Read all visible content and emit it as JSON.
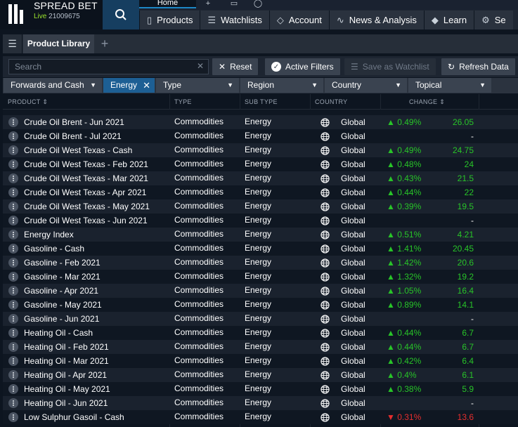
{
  "app": {
    "brand_name": "SPREAD BET",
    "live_label": "Live",
    "account_number": "21009675"
  },
  "top_nav": {
    "home_tab": "Home",
    "items": [
      {
        "label": "Products",
        "icon": "book-icon"
      },
      {
        "label": "Watchlists",
        "icon": "list-icon"
      },
      {
        "label": "Account",
        "icon": "tag-icon"
      },
      {
        "label": "News & Analysis",
        "icon": "pulse-icon"
      },
      {
        "label": "Learn",
        "icon": "mortarboard-icon"
      },
      {
        "label": "Se",
        "icon": "gear-icon"
      }
    ]
  },
  "tabs": {
    "product_library": "Product Library"
  },
  "toolbar": {
    "search_placeholder": "Search",
    "reset_label": "Reset",
    "active_filters_label": "Active Filters",
    "save_watchlist_label": "Save as Watchlist",
    "refresh_label": "Refresh Data"
  },
  "filters": {
    "forwards": "Forwards and Cash",
    "energy": "Energy",
    "type": "Type",
    "region": "Region",
    "country": "Country",
    "topical": "Topical"
  },
  "columns": {
    "product": "PRODUCT",
    "type": "TYPE",
    "sub_type": "SUB TYPE",
    "country": "COUNTRY",
    "change": "CHANGE"
  },
  "rows": [
    {
      "name": "Crude Oil Brent - Jun 2021",
      "type": "Commodities",
      "sub_type": "Energy",
      "country": "Global",
      "change_pct": "0.49%",
      "dir": "up",
      "value": "26.05"
    },
    {
      "name": "Crude Oil Brent - Jul 2021",
      "type": "Commodities",
      "sub_type": "Energy",
      "country": "Global",
      "change_pct": "",
      "dir": "none",
      "value": "-"
    },
    {
      "name": "Crude Oil West Texas - Cash",
      "type": "Commodities",
      "sub_type": "Energy",
      "country": "Global",
      "change_pct": "0.49%",
      "dir": "up",
      "value": "24.75"
    },
    {
      "name": "Crude Oil West Texas - Feb 2021",
      "type": "Commodities",
      "sub_type": "Energy",
      "country": "Global",
      "change_pct": "0.48%",
      "dir": "up",
      "value": "24"
    },
    {
      "name": "Crude Oil West Texas - Mar 2021",
      "type": "Commodities",
      "sub_type": "Energy",
      "country": "Global",
      "change_pct": "0.43%",
      "dir": "up",
      "value": "21.5"
    },
    {
      "name": "Crude Oil West Texas - Apr 2021",
      "type": "Commodities",
      "sub_type": "Energy",
      "country": "Global",
      "change_pct": "0.44%",
      "dir": "up",
      "value": "22"
    },
    {
      "name": "Crude Oil West Texas - May 2021",
      "type": "Commodities",
      "sub_type": "Energy",
      "country": "Global",
      "change_pct": "0.39%",
      "dir": "up",
      "value": "19.5"
    },
    {
      "name": "Crude Oil West Texas - Jun 2021",
      "type": "Commodities",
      "sub_type": "Energy",
      "country": "Global",
      "change_pct": "",
      "dir": "none",
      "value": "-"
    },
    {
      "name": "Energy Index",
      "type": "Commodities",
      "sub_type": "Energy",
      "country": "Global",
      "change_pct": "0.51%",
      "dir": "up",
      "value": "4.21"
    },
    {
      "name": "Gasoline - Cash",
      "type": "Commodities",
      "sub_type": "Energy",
      "country": "Global",
      "change_pct": "1.41%",
      "dir": "up",
      "value": "20.45"
    },
    {
      "name": "Gasoline - Feb 2021",
      "type": "Commodities",
      "sub_type": "Energy",
      "country": "Global",
      "change_pct": "1.42%",
      "dir": "up",
      "value": "20.6"
    },
    {
      "name": "Gasoline - Mar 2021",
      "type": "Commodities",
      "sub_type": "Energy",
      "country": "Global",
      "change_pct": "1.32%",
      "dir": "up",
      "value": "19.2"
    },
    {
      "name": "Gasoline - Apr 2021",
      "type": "Commodities",
      "sub_type": "Energy",
      "country": "Global",
      "change_pct": "1.05%",
      "dir": "up",
      "value": "16.4"
    },
    {
      "name": "Gasoline - May 2021",
      "type": "Commodities",
      "sub_type": "Energy",
      "country": "Global",
      "change_pct": "0.89%",
      "dir": "up",
      "value": "14.1"
    },
    {
      "name": "Gasoline - Jun 2021",
      "type": "Commodities",
      "sub_type": "Energy",
      "country": "Global",
      "change_pct": "",
      "dir": "none",
      "value": "-"
    },
    {
      "name": "Heating Oil - Cash",
      "type": "Commodities",
      "sub_type": "Energy",
      "country": "Global",
      "change_pct": "0.44%",
      "dir": "up",
      "value": "6.7"
    },
    {
      "name": "Heating Oil - Feb 2021",
      "type": "Commodities",
      "sub_type": "Energy",
      "country": "Global",
      "change_pct": "0.44%",
      "dir": "up",
      "value": "6.7"
    },
    {
      "name": "Heating Oil - Mar 2021",
      "type": "Commodities",
      "sub_type": "Energy",
      "country": "Global",
      "change_pct": "0.42%",
      "dir": "up",
      "value": "6.4"
    },
    {
      "name": "Heating Oil - Apr 2021",
      "type": "Commodities",
      "sub_type": "Energy",
      "country": "Global",
      "change_pct": "0.4%",
      "dir": "up",
      "value": "6.1"
    },
    {
      "name": "Heating Oil - May 2021",
      "type": "Commodities",
      "sub_type": "Energy",
      "country": "Global",
      "change_pct": "0.38%",
      "dir": "up",
      "value": "5.9"
    },
    {
      "name": "Heating Oil - Jun 2021",
      "type": "Commodities",
      "sub_type": "Energy",
      "country": "Global",
      "change_pct": "",
      "dir": "none",
      "value": "-"
    },
    {
      "name": "Low Sulphur Gasoil - Cash",
      "type": "Commodities",
      "sub_type": "Energy",
      "country": "Global",
      "change_pct": "0.31%",
      "dir": "down",
      "value": "13.6"
    }
  ],
  "colors": {
    "positive": "#28c428",
    "negative": "#e62e2e",
    "accent": "#1d5f94"
  }
}
